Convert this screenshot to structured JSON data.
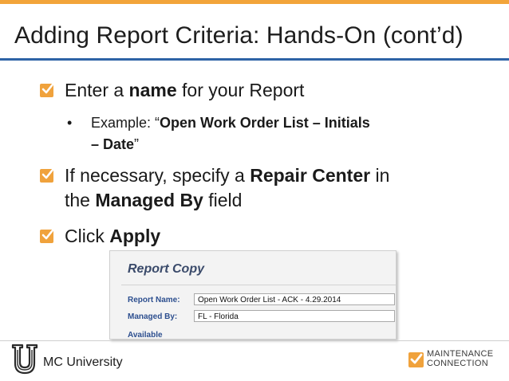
{
  "slide": {
    "title": "Adding Report Criteria: Hands-On (cont’d)",
    "bullets": [
      {
        "pre": "Enter a ",
        "bold": "name",
        "post": " for your Report"
      },
      {
        "line1_pre": "If necessary, specify a ",
        "line1_bold": "Repair Center",
        "line1_post": " in",
        "line2_pre": "the ",
        "line2_bold": "Managed By",
        "line2_post": " field"
      },
      {
        "pre": "Click ",
        "bold": "Apply"
      }
    ],
    "sub_bullet": {
      "marker": "•",
      "pre": "Example: “",
      "bold1": "Open Work Order List – Initials",
      "bold2": "– Date",
      "post": "”"
    }
  },
  "screenshot": {
    "title": "Report Copy",
    "report_name_label": "Report Name:",
    "report_name_value": "Open Work Order List - ACK - 4.29.2014",
    "managed_by_label": "Managed By:",
    "managed_by_value": "FL - Florida",
    "available_label": "Available"
  },
  "footer": {
    "left_text": "MC University",
    "brand_line1": "MAINTENANCE",
    "brand_line2": "CONNECTION"
  },
  "colors": {
    "accent_orange": "#f2a43a",
    "title_rule_blue": "#2e63a6",
    "checkbox": "#f0a23c"
  },
  "icons": [
    "checkbox-icon",
    "u-logo-icon",
    "maintenance-connection-logo-icon"
  ]
}
